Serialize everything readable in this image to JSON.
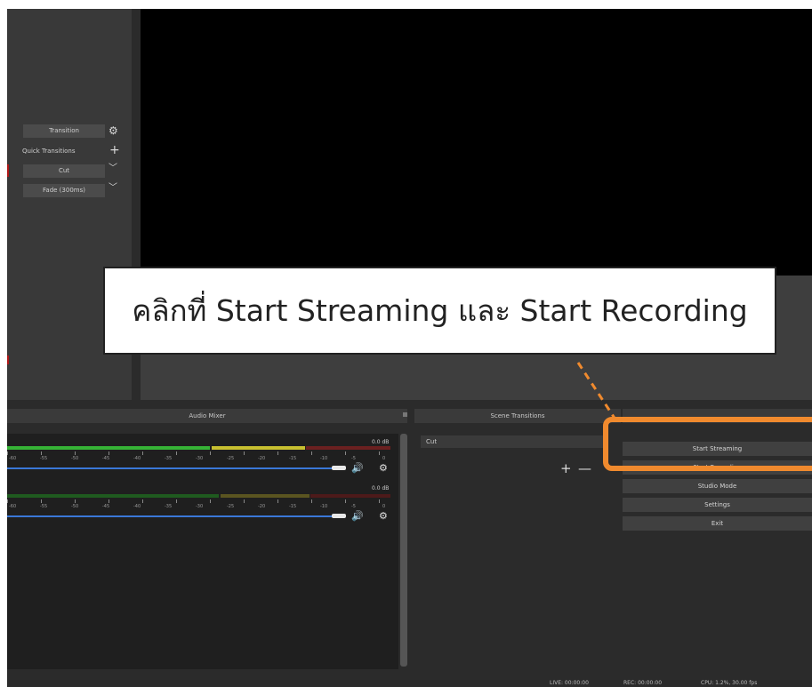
{
  "transitions": {
    "transition_label": "Transition",
    "quick_transitions_label": "Quick Transitions",
    "cut_label": "Cut",
    "fade_label": "Fade (300ms)"
  },
  "annotation": {
    "callout_text": "คลิกที่ Start Streaming และ Start Recording",
    "highlight_color": "#f08a2e"
  },
  "docks": {
    "audio_mixer_title": "Audio Mixer",
    "scene_transitions_title": "Scene Transitions"
  },
  "audio": {
    "channels": [
      {
        "db_label": "0.0 dB"
      },
      {
        "db_label": "0.0 dB"
      }
    ],
    "tick_labels": [
      "-60",
      "-55",
      "-50",
      "-45",
      "-40",
      "-35",
      "-30",
      "-25",
      "-20",
      "-15",
      "-10",
      "-5",
      "0"
    ]
  },
  "scenes": {
    "items": [
      "Cut"
    ]
  },
  "controls": {
    "start_streaming": "Start Streaming",
    "start_recording": "Start Recording",
    "studio_mode": "Studio Mode",
    "settings": "Settings",
    "exit": "Exit"
  },
  "status": {
    "live": "LIVE: 00:00:00",
    "rec": "REC: 00:00:00",
    "cpu": "CPU: 1.2%, 30.00 fps"
  },
  "colors": {
    "meter_green": "#36b336",
    "meter_yellow": "#c8c030",
    "meter_red": "#b52a2a",
    "fader_blue": "#3a78d8"
  }
}
